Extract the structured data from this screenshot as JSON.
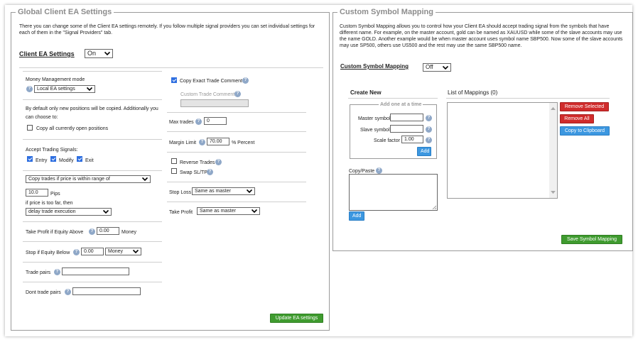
{
  "global": {
    "title": "Global Client EA Settings",
    "intro": "There you can change some of the Client EA settings remotely. If you follow multiple signal providers you can set individual settings for each of them in the \"Signal Providers\" tab.",
    "client_ea_label": "Client EA Settings",
    "client_ea_value": "On",
    "money_mode_label": "Money Management mode",
    "money_mode_value": "Local EA settings",
    "copy_note": "By default only new positions will be copied. Additionally you can choose to:",
    "copy_open_label": "Copy all currently open positions",
    "accept_signals_label": "Accept Trading Signals:",
    "entry_label": "Entry",
    "modify_label": "Modify",
    "exit_label": "Exit",
    "price_range_value": "Copy trades if price is within range of",
    "pips_value": "10.0",
    "pips_label": "Pips",
    "too_far_label": "if price is too far, then",
    "delay_value": "delay trade execution",
    "tp_equity_label": "Take Profit if Equity Above",
    "tp_equity_value": "0.00",
    "money_label": "Money",
    "stop_equity_label": "Stop if Equity Below",
    "stop_equity_value": "0.00",
    "stop_equity_unit": "Money",
    "trade_pairs_label": "Trade pairs",
    "dont_trade_label": "Dont trade pairs",
    "copy_comment_label": "Copy Exact Trade Comment",
    "custom_comment_label": "Custom Trade Comment",
    "max_trades_label": "Max trades",
    "max_trades_value": "0",
    "margin_label": "Margin Limit",
    "margin_value": "70.00",
    "percent_label": "% Percent",
    "reverse_label": "Reverse Trades",
    "swap_label": "Swap SL/TP",
    "stop_loss_label": "Stop Loss",
    "stop_loss_value": "Same as master",
    "take_profit_label": "Take Profit",
    "take_profit_value": "Same as master",
    "update_button": "Update EA settings"
  },
  "mapping": {
    "title": "Custom Symbol Mapping",
    "intro": "Custom Symbol Mapping allows you to control how your Client EA should accept trading signal from the symbols that have different name. For example, on the master account, gold can be named as XAUUSD while some of the slave accounts may use the name GOLD. Another example would be when master account uses symbol name SBP500. Now some of the slave accounts may use SP500, others use US500 and the rest may use the same SBP500 name.",
    "mapping_label": "Custom Symbol Mapping",
    "mapping_value": "Off",
    "create_new": "Create New",
    "add_one": "Add one at a time",
    "master_symbol": "Master symbol",
    "slave_symbol": "Slave symbol",
    "scale_factor": "Scale factor",
    "scale_value": "1.00",
    "add_button": "Add",
    "copy_paste": "Copy/Paste",
    "add_button2": "Add",
    "list_title": "List of Mappings (0)",
    "remove_selected": "Remove Selected",
    "remove_all": "Remove All",
    "copy_clipboard": "Copy to Clipboard",
    "save_button": "Save Symbol Mapping"
  },
  "icons": {
    "help": "question-mark-circle",
    "dropdown": "chevron-down"
  },
  "colors": {
    "green_button": "#3f9b2f",
    "red_button": "#d02b2b",
    "blue_button": "#3c97e0",
    "help_icon": "#8fa8c8"
  }
}
